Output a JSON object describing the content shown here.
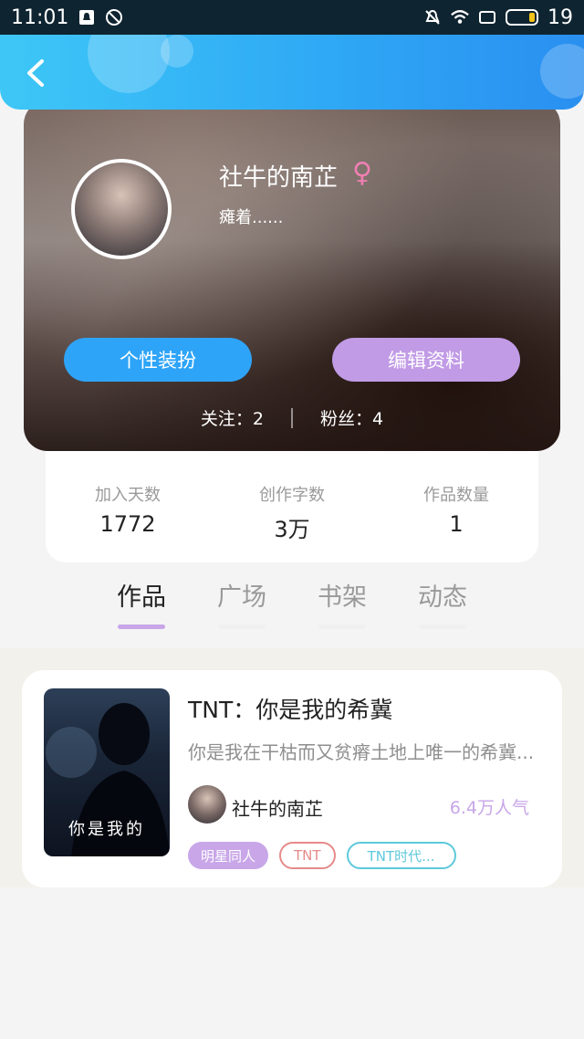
{
  "status_bar": {
    "time": "11:01",
    "battery": "19",
    "icons": [
      "notification-icon",
      "dnd-icon",
      "mute-icon",
      "wifi-icon",
      "screen-icon",
      "battery-icon"
    ]
  },
  "header": {
    "back_icon": "chevron-left-icon",
    "colors": {
      "start": "#3ec7f6",
      "end": "#2a8ff0"
    }
  },
  "profile": {
    "name": "社牛的南芷",
    "gender_symbol": "♀",
    "bio": "瘫着......",
    "buttons": {
      "dress": "个性装扮",
      "edit": "编辑资料"
    },
    "follow": "关注：2",
    "fans": "粉丝：4"
  },
  "stats": [
    {
      "label": "加入天数",
      "value": "1772"
    },
    {
      "label": "创作字数",
      "value": "3万"
    },
    {
      "label": "作品数量",
      "value": "1"
    }
  ],
  "tabs": [
    {
      "label": "作品",
      "active": true
    },
    {
      "label": "广场",
      "active": false
    },
    {
      "label": "书架",
      "active": false
    },
    {
      "label": "动态",
      "active": false
    }
  ],
  "work": {
    "cover_text": "你是我的",
    "title": "TNT：你是我的希冀",
    "description": "你是我在干枯而又贫瘠土地上唯一的希冀...",
    "author": "社牛的南芷",
    "popularity": "6.4万人气",
    "tags": [
      "明星同人",
      "TNT",
      "TNT时代..."
    ]
  }
}
